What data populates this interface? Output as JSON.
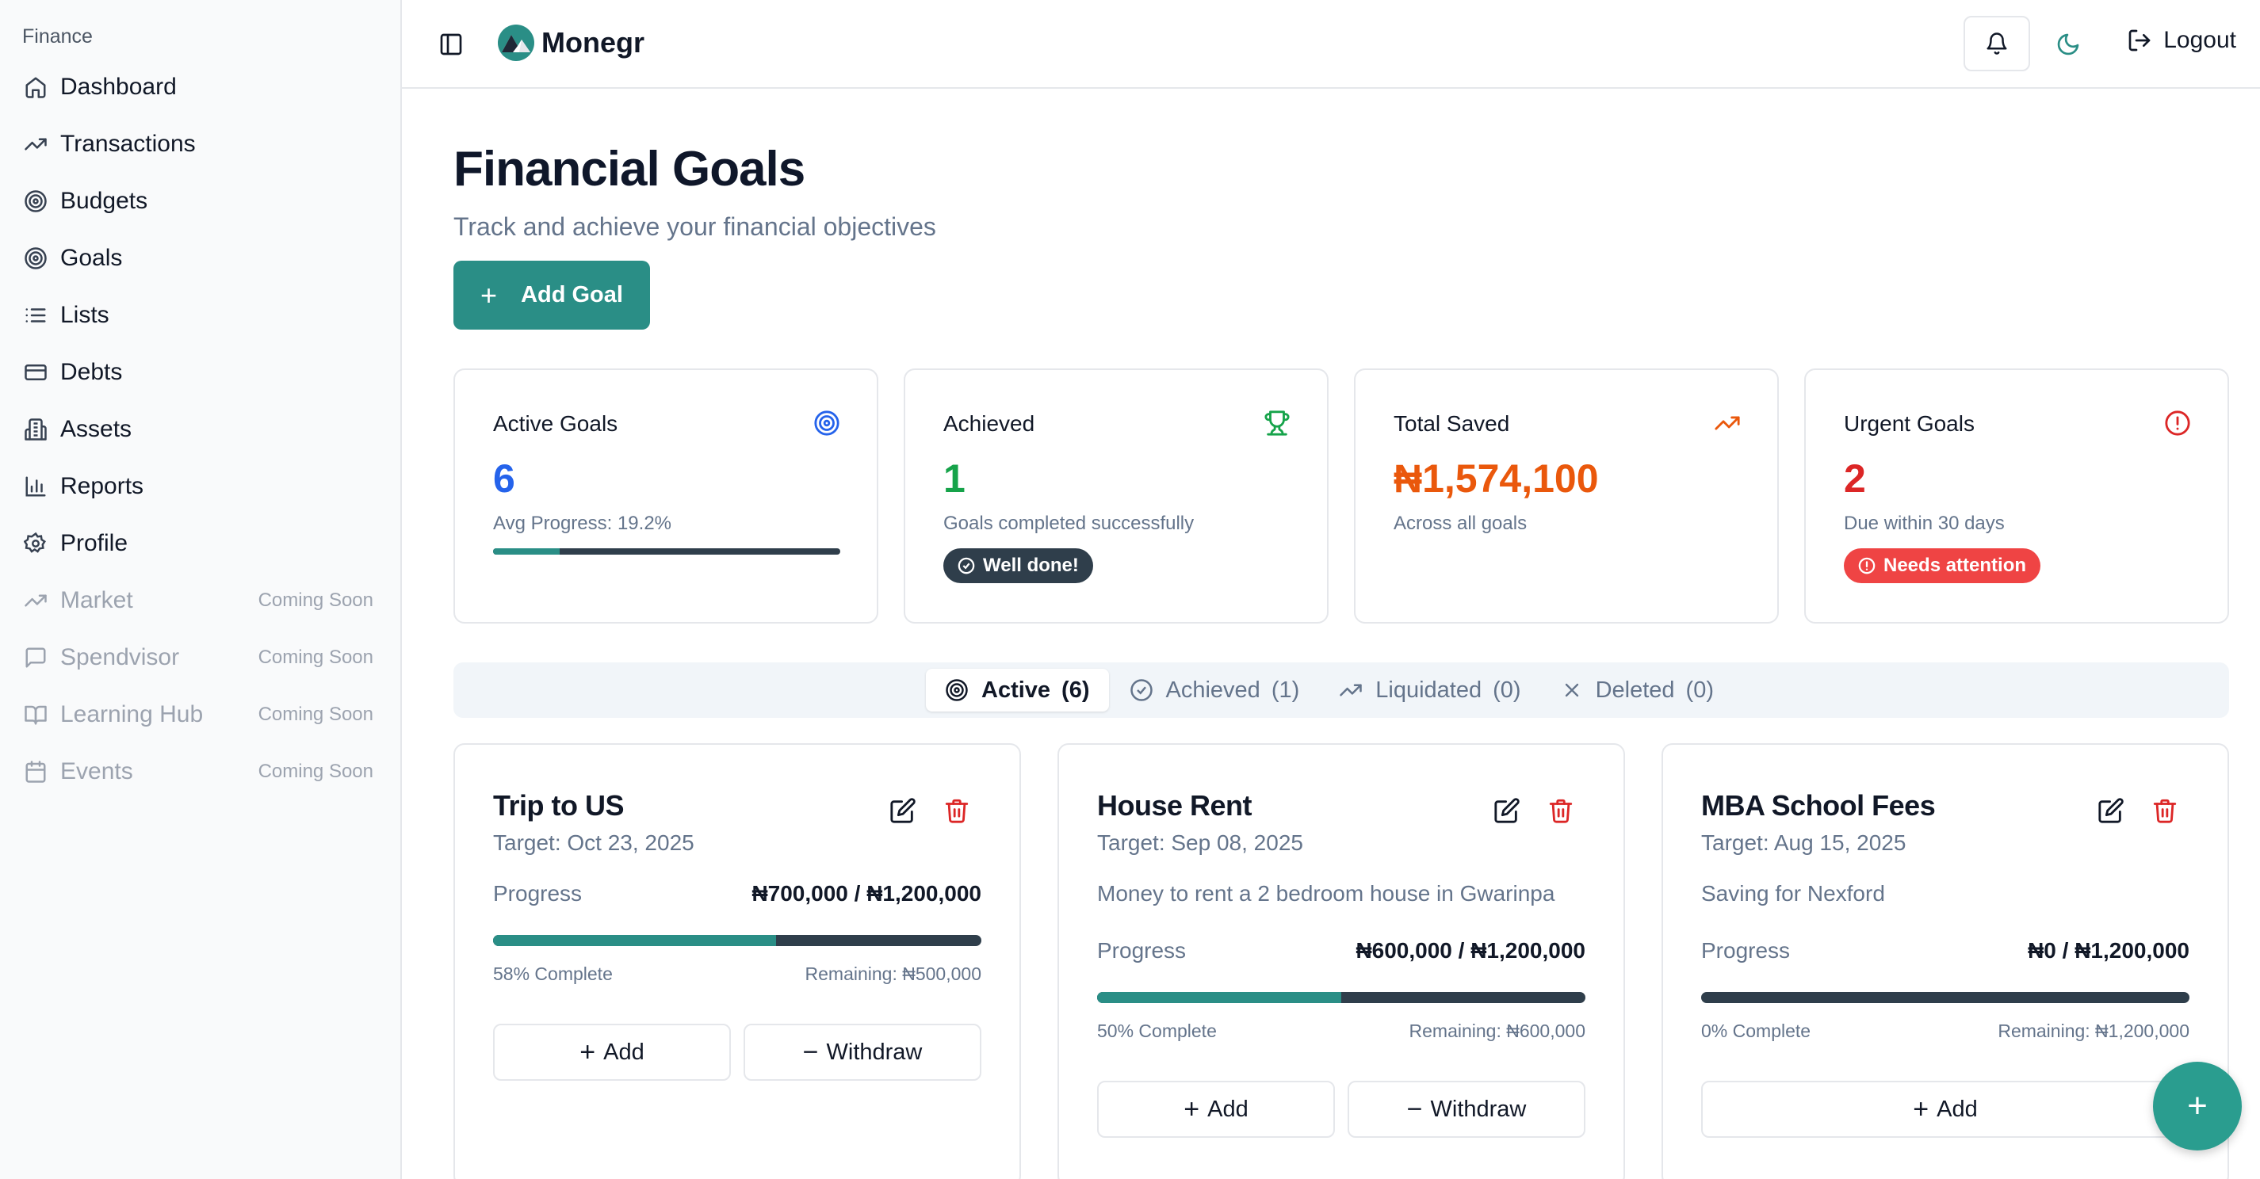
{
  "sidebar": {
    "group_label": "Finance",
    "items": [
      {
        "label": "Dashboard",
        "icon": "home-icon"
      },
      {
        "label": "Transactions",
        "icon": "trending-up-icon"
      },
      {
        "label": "Budgets",
        "icon": "target-icon"
      },
      {
        "label": "Goals",
        "icon": "target-icon"
      },
      {
        "label": "Lists",
        "icon": "list-icon"
      },
      {
        "label": "Debts",
        "icon": "credit-card-icon"
      },
      {
        "label": "Assets",
        "icon": "building-icon"
      },
      {
        "label": "Reports",
        "icon": "bar-chart-icon"
      },
      {
        "label": "Profile",
        "icon": "gear-icon"
      },
      {
        "label": "Market",
        "icon": "trending-up-icon",
        "badge": "Coming Soon"
      },
      {
        "label": "Spendvisor",
        "icon": "message-icon",
        "badge": "Coming Soon"
      },
      {
        "label": "Learning Hub",
        "icon": "book-icon",
        "badge": "Coming Soon"
      },
      {
        "label": "Events",
        "icon": "calendar-icon",
        "badge": "Coming Soon"
      }
    ]
  },
  "header": {
    "brand": "Monegr",
    "logout_label": "Logout"
  },
  "main": {
    "title": "Financial Goals",
    "subtitle": "Track and achieve your financial objectives",
    "add_goal_label": "Add Goal"
  },
  "stats": {
    "active": {
      "label": "Active Goals",
      "value": "6",
      "sub": "Avg Progress: 19.2%",
      "progress": 0.192,
      "color": "#2563eb"
    },
    "achieved": {
      "label": "Achieved",
      "value": "1",
      "sub": "Goals completed successfully",
      "badge": "Well done!",
      "color": "#16a34a"
    },
    "saved": {
      "label": "Total Saved",
      "value": "₦1,574,100",
      "sub": "Across all goals",
      "color": "#ea580c"
    },
    "urgent": {
      "label": "Urgent Goals",
      "value": "2",
      "sub": "Due within 30 days",
      "badge": "Needs attention",
      "color": "#dc2626"
    }
  },
  "tabs": [
    {
      "label": "Active",
      "count": "(6)",
      "active": true
    },
    {
      "label": "Achieved",
      "count": "(1)",
      "active": false
    },
    {
      "label": "Liquidated",
      "count": "(0)",
      "active": false
    },
    {
      "label": "Deleted",
      "count": "(0)",
      "active": false
    }
  ],
  "goals": [
    {
      "title": "Trip to US",
      "target": "Target: Oct 23, 2025",
      "description": "",
      "progress_label": "Progress",
      "amount": "₦700,000 / ₦1,200,000",
      "percent": 58,
      "complete": "58% Complete",
      "remaining": "Remaining: ₦500,000",
      "add_label": "Add",
      "withdraw_label": "Withdraw"
    },
    {
      "title": "House Rent",
      "target": "Target: Sep 08, 2025",
      "description": "Money to rent a 2 bedroom house in Gwarinpa",
      "progress_label": "Progress",
      "amount": "₦600,000 / ₦1,200,000",
      "percent": 50,
      "complete": "50% Complete",
      "remaining": "Remaining: ₦600,000",
      "add_label": "Add",
      "withdraw_label": "Withdraw"
    },
    {
      "title": "MBA School Fees",
      "target": "Target: Aug 15, 2025",
      "description": "Saving for Nexford",
      "progress_label": "Progress",
      "amount": "₦0 / ₦1,200,000",
      "percent": 0,
      "complete": "0% Complete",
      "remaining": "Remaining: ₦1,200,000",
      "add_label": "Add"
    }
  ],
  "fab_label": "+"
}
